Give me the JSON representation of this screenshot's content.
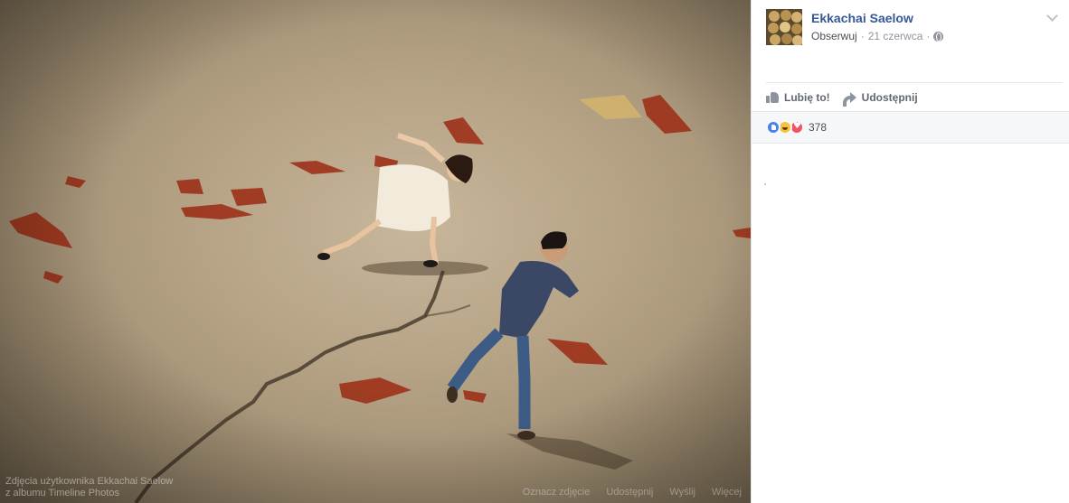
{
  "photo": {
    "caption_line1": "Zdjęcia użytkownika Ekkachai Saelow",
    "caption_line2": "z albumu Timeline Photos",
    "actions": [
      "Oznacz zdjęcie",
      "Udostępnij",
      "Wyślij",
      "Więcej"
    ]
  },
  "post": {
    "author": "Ekkachai Saelow",
    "follow_label": "Obserwuj",
    "separator": "·",
    "date": "21 czerwca",
    "privacy_icon": "globe-icon",
    "menu_icon": "chevron-down-icon"
  },
  "actions": {
    "like_label": "Lubię to!",
    "share_label": "Udostępnij"
  },
  "reactions": {
    "icons": [
      "like-reaction-icon",
      "haha-reaction-icon",
      "love-reaction-icon"
    ],
    "count": "378"
  },
  "colors": {
    "link_blue": "#365899",
    "like_blue": "#4a7ff2",
    "haha_yellow": "#f5c33b",
    "love_red": "#f25268"
  }
}
